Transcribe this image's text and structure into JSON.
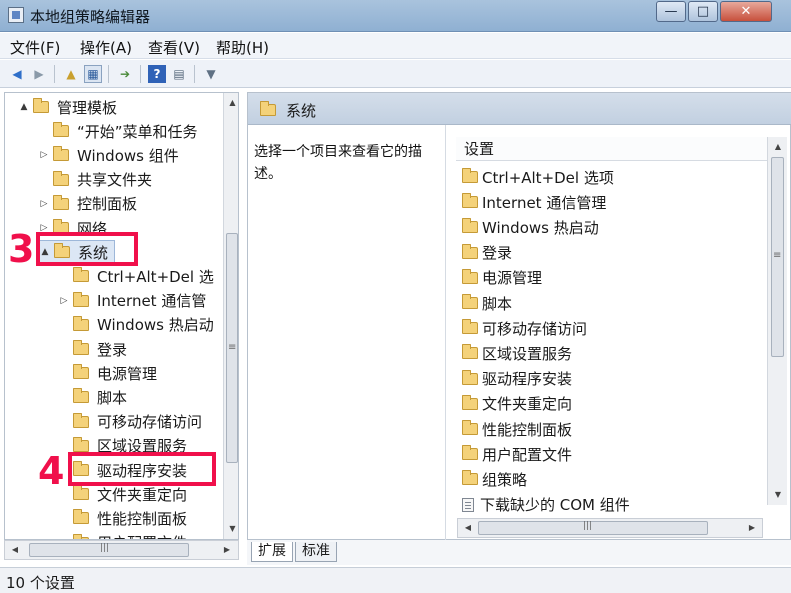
{
  "window": {
    "title": "本地组策略编辑器",
    "minimize": "—",
    "maximize": "□",
    "close": "✕"
  },
  "menu": [
    "文件(F)",
    "操作(A)",
    "查看(V)",
    "帮助(H)"
  ],
  "toolbar": {
    "icons": [
      "back-icon",
      "forward-icon",
      "up-folder-icon",
      "show-tree-icon",
      "export-icon",
      "help-icon",
      "properties-icon",
      "filter-icon"
    ]
  },
  "tree": {
    "items": [
      {
        "label": "管理模板",
        "level": 0,
        "expander": "▲"
      },
      {
        "label": "“开始”菜单和任务",
        "level": 1,
        "expander": ""
      },
      {
        "label": "Windows 组件",
        "level": 1,
        "expander": "▷"
      },
      {
        "label": "共享文件夹",
        "level": 1,
        "expander": ""
      },
      {
        "label": "控制面板",
        "level": 1,
        "expander": "▷"
      },
      {
        "label": "网络",
        "level": 1,
        "expander": "▷"
      },
      {
        "label": "系统",
        "level": 1,
        "expander": "▲",
        "selected": true
      },
      {
        "label": "Ctrl+Alt+Del 选",
        "level": 2,
        "expander": ""
      },
      {
        "label": "Internet 通信管",
        "level": 2,
        "expander": "▷"
      },
      {
        "label": "Windows 热启动",
        "level": 2,
        "expander": ""
      },
      {
        "label": "登录",
        "level": 2,
        "expander": ""
      },
      {
        "label": "电源管理",
        "level": 2,
        "expander": ""
      },
      {
        "label": "脚本",
        "level": 2,
        "expander": ""
      },
      {
        "label": "可移动存储访问",
        "level": 2,
        "expander": ""
      },
      {
        "label": "区域设置服务",
        "level": 2,
        "expander": ""
      },
      {
        "label": "驱动程序安装",
        "level": 2,
        "expander": ""
      },
      {
        "label": "文件夹重定向",
        "level": 2,
        "expander": ""
      },
      {
        "label": "性能控制面板",
        "level": 2,
        "expander": ""
      },
      {
        "label": "用户配置文件",
        "level": 2,
        "expander": ""
      }
    ]
  },
  "right": {
    "header_title": "系统",
    "description": "选择一个项目来查看它的描述。",
    "list_header": "设置",
    "items": [
      {
        "label": "Ctrl+Alt+Del 选项",
        "icon": "folder-icon"
      },
      {
        "label": "Internet 通信管理",
        "icon": "folder-icon"
      },
      {
        "label": "Windows 热启动",
        "icon": "folder-icon"
      },
      {
        "label": "登录",
        "icon": "folder-icon"
      },
      {
        "label": "电源管理",
        "icon": "folder-icon"
      },
      {
        "label": "脚本",
        "icon": "folder-icon"
      },
      {
        "label": "可移动存储访问",
        "icon": "folder-icon"
      },
      {
        "label": "区域设置服务",
        "icon": "folder-icon"
      },
      {
        "label": "驱动程序安装",
        "icon": "folder-icon"
      },
      {
        "label": "文件夹重定向",
        "icon": "folder-icon"
      },
      {
        "label": "性能控制面板",
        "icon": "folder-icon"
      },
      {
        "label": "用户配置文件",
        "icon": "folder-icon"
      },
      {
        "label": "组策略",
        "icon": "folder-icon"
      },
      {
        "label": "下载缺少的 COM 组件",
        "icon": "policy-setting-icon"
      }
    ]
  },
  "tabs": [
    "扩展",
    "标准"
  ],
  "status": "10 个设置",
  "annotations": [
    {
      "number": "3",
      "target": "系统"
    },
    {
      "number": "4",
      "target": "驱动程序安装"
    }
  ],
  "scroll_glyphs": {
    "up": "▲",
    "down": "▼",
    "left": "◀",
    "right": "▶",
    "grip_v": "≡",
    "grip_h": "|||"
  },
  "colors": {
    "annotation": "#f0104b",
    "folder": "#f4d27a",
    "header_bg": "#c2d0e1"
  }
}
